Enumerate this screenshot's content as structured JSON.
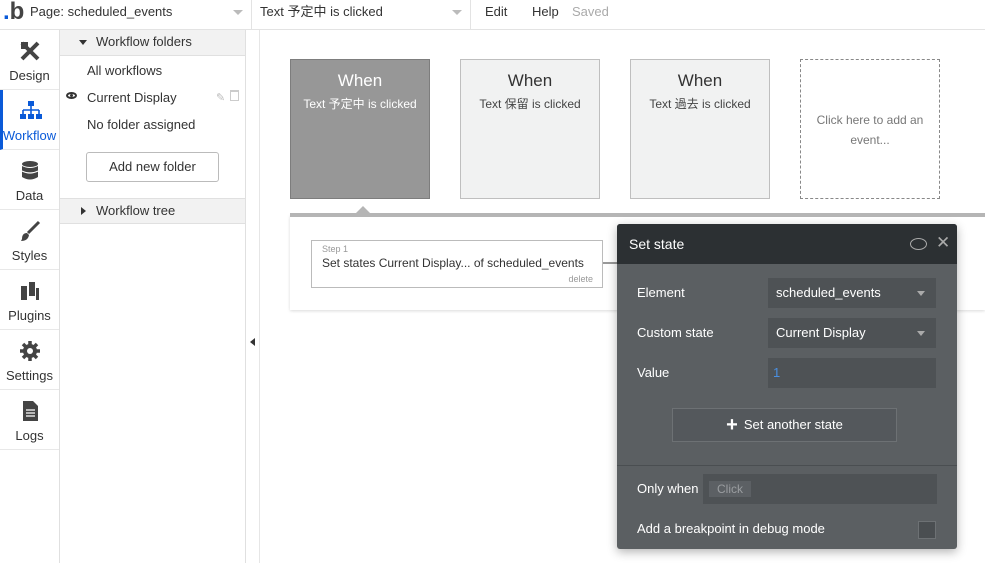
{
  "topbar": {
    "logo": "b",
    "page_select": "Page: scheduled_events",
    "event_select": "Text 予定中 is clicked",
    "menu_edit": "Edit",
    "menu_help": "Help",
    "status": "Saved"
  },
  "nav": {
    "items": [
      {
        "label": "Design",
        "icon": "design-icon"
      },
      {
        "label": "Workflow",
        "icon": "workflow-icon"
      },
      {
        "label": "Data",
        "icon": "database-icon"
      },
      {
        "label": "Styles",
        "icon": "brush-icon"
      },
      {
        "label": "Plugins",
        "icon": "plug-icon"
      },
      {
        "label": "Settings",
        "icon": "gear-icon"
      },
      {
        "label": "Logs",
        "icon": "document-icon"
      }
    ],
    "active": "Workflow"
  },
  "folders": {
    "header": "Workflow folders",
    "items": [
      "All workflows",
      "Current Display",
      "No folder assigned"
    ],
    "add_button": "Add new folder",
    "tree_header": "Workflow tree"
  },
  "events": [
    {
      "when": "When",
      "text": "Text 予定中 is clicked",
      "selected": true
    },
    {
      "when": "When",
      "text": "Text 保留 is clicked",
      "selected": false
    },
    {
      "when": "When",
      "text": "Text 過去 is clicked",
      "selected": false
    }
  ],
  "add_event": "Click here to add an event...",
  "step": {
    "label": "Step 1",
    "text": "Set states Current Display... of scheduled_events",
    "delete": "delete"
  },
  "panel": {
    "title": "Set state",
    "element_label": "Element",
    "element_value": "scheduled_events",
    "state_label": "Custom state",
    "state_value": "Current Display",
    "value_label": "Value",
    "value_value": "1",
    "another_button": "Set another state",
    "only_when_label": "Only when",
    "only_when_chip": "Click",
    "breakpoint_label": "Add a breakpoint in debug mode"
  },
  "colors": {
    "accent": "#0a5ad8",
    "panel_bg": "#5b5f62",
    "panel_head": "#2c3033",
    "selected_card": "#979797"
  }
}
